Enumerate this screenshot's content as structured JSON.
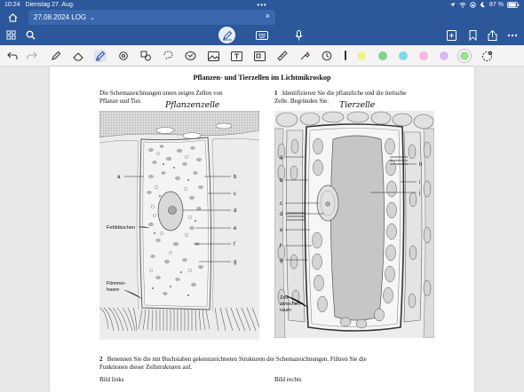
{
  "status": {
    "time": "10:24",
    "date": "Dienstag 27. Aug.",
    "dots": "•••",
    "battery": "87 %"
  },
  "tab": {
    "title": "27.08.2024 LOG",
    "chevron": "⌄",
    "close": "×"
  },
  "toolbar_icons": [
    "sidebar-icon",
    "search-icon",
    "pen-mode-icon",
    "keyboard-icon",
    "microphone-icon",
    "add-page-icon",
    "bookmark-icon",
    "share-icon",
    "more-icon"
  ],
  "tools": [
    "undo-icon",
    "redo-icon",
    "pen-icon",
    "eraser-icon",
    "highlighter-icon",
    "shapes-icon",
    "lasso-icon",
    "selection-icon",
    "sticker-icon",
    "image-icon",
    "text-icon",
    "scan-icon",
    "ruler-icon",
    "laser-icon",
    "timer-icon"
  ],
  "colors": [
    "#f2f08f",
    "#7fd68a",
    "#7fd8ea",
    "#f4b6e0",
    "#d6b8f0",
    "#9fdf93"
  ],
  "document": {
    "title": "Pflanzen- und Tierzellen im Lichtmikroskop",
    "intro_line1": "Die Schemazeichnungen unten zeigen Zellen von",
    "intro_line2": "Pflanze und Tier.",
    "handwriting_left": "Pflanzenzelle",
    "task1_number": "1",
    "task1_line1": "Identifizieren Sie die pflanzliche und die tierische",
    "task1_line2": "Zelle. Begründen Sie.",
    "handwriting_right": "Tierzelle",
    "task2_number": "2",
    "task2_line1": "Benennen Sie die mit Buchstaben gekennzeichneten Strukturen der Schemazeichnungen. Führen Sie die",
    "task2_line2": "Funktionen dieser Zellstrukturen auf.",
    "bild_links": "Bild links",
    "bild_rechts": "Bild rechts"
  },
  "figure_left": {
    "labels": {
      "a": "a",
      "b": "b",
      "c": "c",
      "d": "d",
      "e": "e",
      "f": "f",
      "g": "g"
    },
    "fettblaeschen": "Fettbläschen",
    "flimmer1": "Flimmer-",
    "flimmer2": "haare"
  },
  "figure_right": {
    "labels": {
      "a": "a",
      "b": "b",
      "c": "c",
      "d": "d",
      "e": "e",
      "f": "f",
      "g": "g",
      "h": "h",
      "i": "i",
      "j": "j"
    },
    "zell1": "Zell-",
    "zell2": "zwischen-",
    "zell3": "raum"
  }
}
